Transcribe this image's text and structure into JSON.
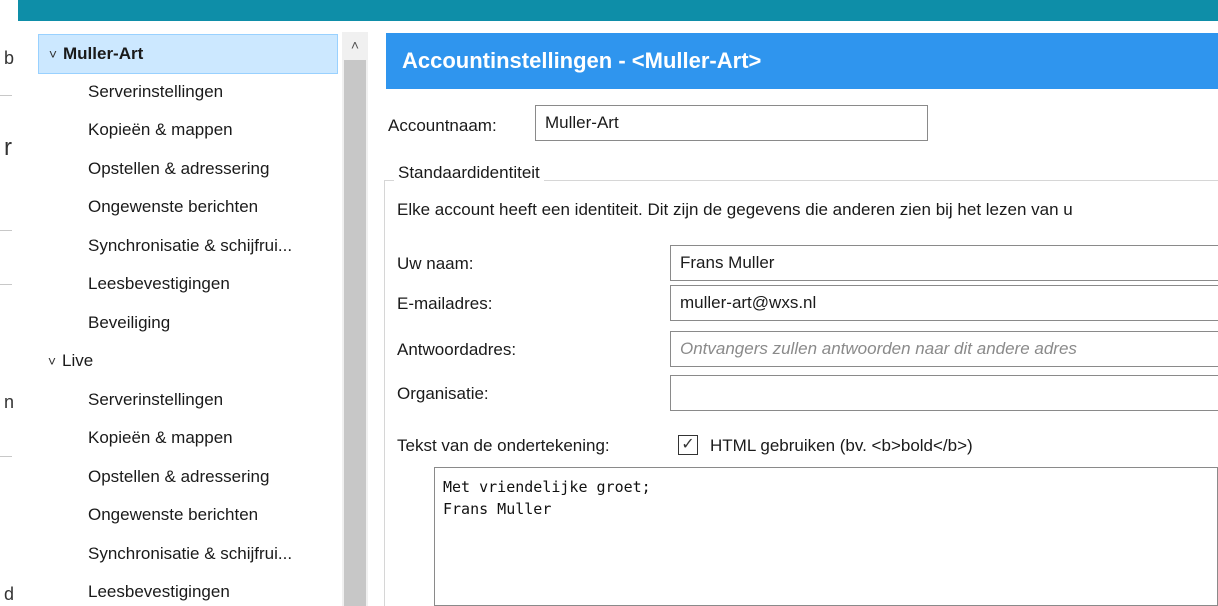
{
  "left_fragments": [
    "b",
    "r",
    "n",
    "d"
  ],
  "tree": {
    "accounts": [
      {
        "label": "Muller-Art",
        "selected": true,
        "children": [
          "Serverinstellingen",
          "Kopieën & mappen",
          "Opstellen & adressering",
          "Ongewenste berichten",
          "Synchronisatie & schijfrui...",
          "Leesbevestigingen",
          "Beveiliging"
        ]
      },
      {
        "label": "Live",
        "selected": false,
        "children": [
          "Serverinstellingen",
          "Kopieën & mappen",
          "Opstellen & adressering",
          "Ongewenste berichten",
          "Synchronisatie & schijfrui...",
          "Leesbevestigingen"
        ]
      }
    ]
  },
  "banner": {
    "title": "Accountinstellingen - <Muller-Art>"
  },
  "account_name": {
    "label": "Accountnaam:",
    "value": "Muller-Art"
  },
  "identity": {
    "legend": "Standaardidentiteit",
    "description": "Elke account heeft een identiteit. Dit zijn de gegevens die anderen zien bij het lezen van u",
    "name": {
      "label": "Uw naam:",
      "value": "Frans Muller"
    },
    "email": {
      "label": "E-mailadres:",
      "value": "muller-art@wxs.nl"
    },
    "reply_to": {
      "label": "Antwoordadres:",
      "value": "",
      "placeholder": "Ontvangers zullen antwoorden naar dit andere adres"
    },
    "organization": {
      "label": "Organisatie:",
      "value": ""
    },
    "signature": {
      "label": "Tekst van de ondertekening:",
      "html_checkbox_label": "HTML gebruiken (bv. <b>bold</b>)",
      "html_checked": true,
      "text": "Met vriendelijke groet;\nFrans Muller"
    }
  },
  "icons": {
    "chevron_down": "˅",
    "scroll_up": "˄",
    "check": "✓"
  },
  "colors": {
    "topbar": "#0e8ea8",
    "banner": "#2f95ee",
    "selection": "#cce8ff"
  }
}
